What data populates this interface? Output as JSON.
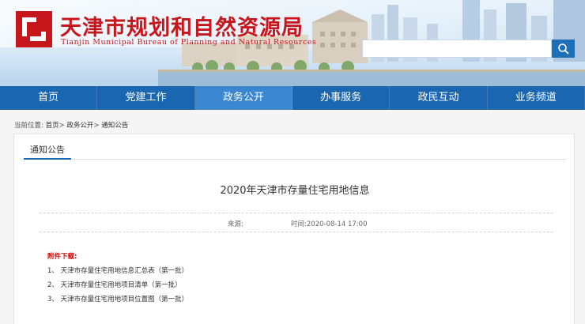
{
  "header": {
    "title": "天津市规划和自然资源局",
    "subtitle": "Tianjin Municipal Bureau of Planning and Natural Resources",
    "search_placeholder": ""
  },
  "nav": {
    "items": [
      {
        "label": "首页"
      },
      {
        "label": "党建工作"
      },
      {
        "label": "政务公开"
      },
      {
        "label": "办事服务"
      },
      {
        "label": "政民互动"
      },
      {
        "label": "业务频道"
      }
    ],
    "active_index": 2
  },
  "breadcrumb": {
    "prefix": "当前位置:",
    "items": [
      "首页",
      "政务公开",
      "通知公告"
    ],
    "separator": ">"
  },
  "section": {
    "tab_label": "通知公告"
  },
  "article": {
    "title": "2020年天津市存量住宅用地信息",
    "source_label": "来源:",
    "source_value": "",
    "time_label": "时间:",
    "time_value": "2020-08-14 17:00"
  },
  "attachments": {
    "heading": "附件下载:",
    "items": [
      {
        "label": "1、 天津市存量住宅用地信息汇总表（第一批）"
      },
      {
        "label": "2、 天津市存量住宅用地项目清单（第一批）"
      },
      {
        "label": "3、 天津市存量住宅用地项目位置图（第一批）"
      }
    ]
  },
  "colors": {
    "brand_red": "#c8161d",
    "nav_blue": "#1a66b0",
    "nav_active": "#3a86cf",
    "attachment_heading": "#d40000"
  },
  "icons": {
    "search": "search-icon"
  }
}
